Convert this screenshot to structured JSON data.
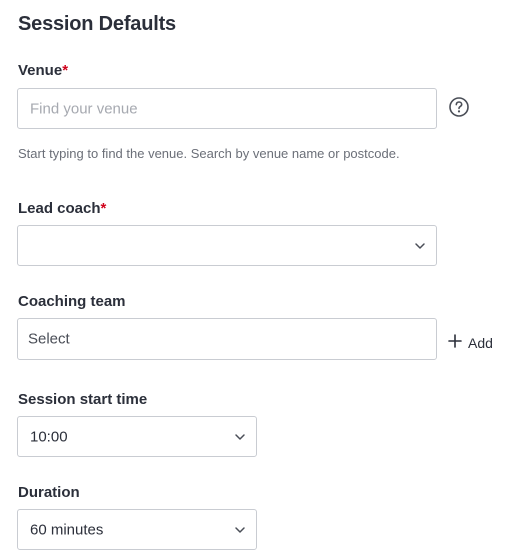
{
  "page": {
    "title": "Session Defaults"
  },
  "venue": {
    "label": "Venue",
    "required_mark": "*",
    "placeholder": "Find your venue",
    "hint": "Start typing to find the venue. Search by venue name or postcode.",
    "help_icon": "question-circle-icon"
  },
  "lead_coach": {
    "label": "Lead coach",
    "required_mark": "*",
    "value": "",
    "icon": "chevron-down-icon"
  },
  "coaching_team": {
    "label": "Coaching team",
    "placeholder": "Select",
    "add_label": "Add",
    "add_icon": "plus-icon"
  },
  "start_time": {
    "label": "Session start time",
    "value": "10:00",
    "icon": "chevron-down-icon"
  },
  "duration": {
    "label": "Duration",
    "value": "60 minutes",
    "icon": "chevron-down-icon"
  },
  "colors": {
    "text": "#2b2f3a",
    "required": "#d0021b",
    "border": "#c9ccd2",
    "placeholder": "#a6a9b0",
    "hint": "#6b6f78"
  }
}
